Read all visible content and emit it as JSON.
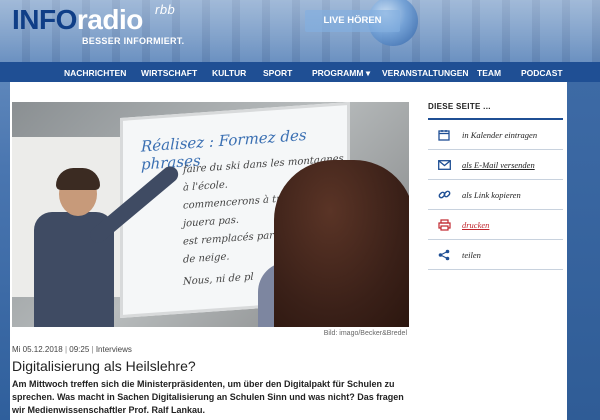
{
  "header": {
    "logo_info": "INFO",
    "logo_radio": "radio",
    "logo_rbb": "rbb",
    "tagline": "BESSER INFORMIERT.",
    "live_label": "LIVE HÖREN"
  },
  "nav": {
    "items": [
      {
        "label": "NACHRICHTEN"
      },
      {
        "label": "WIRTSCHAFT"
      },
      {
        "label": "KULTUR"
      },
      {
        "label": "SPORT"
      },
      {
        "label": "PROGRAMM ▾"
      },
      {
        "label": "VERANSTALTUNGEN"
      },
      {
        "label": "TEAM"
      },
      {
        "label": "PODCAST"
      }
    ]
  },
  "article": {
    "image_caption": "Bild: imago/Becker&Bredel",
    "board_title": "Réalisez : Formez des phrases",
    "board_lines": [
      "faire du ski dans les montagnes.",
      "à l'école.",
      "commencerons à travailler",
      "jouera pas.",
      "est remplacés par des",
      "de neige.",
      "Nous, ni de pl"
    ],
    "date": "Mi 05.12.2018",
    "time": "09:25",
    "category": "Interviews",
    "headline": "Digitalisierung als Heilslehre?",
    "teaser": "Am Mittwoch treffen sich die Ministerpräsidenten, um über den Digitalpakt für Schulen zu sprechen. Was macht in Sachen Digitalisierung an Schulen Sinn und was nicht? Das fragen wir Medienwissenschaftler Prof. Ralf Lankau."
  },
  "sidebar": {
    "title": "DIESE SEITE ...",
    "items": [
      {
        "label": "in Kalender eintragen",
        "icon": "calendar-icon"
      },
      {
        "label": "als E-Mail versenden",
        "icon": "mail-icon"
      },
      {
        "label": "als Link kopieren",
        "icon": "link-icon"
      },
      {
        "label": "drucken",
        "icon": "print-icon"
      },
      {
        "label": "teilen",
        "icon": "share-icon"
      }
    ]
  },
  "colors": {
    "nav_bg": "#1f4f94",
    "accent_red": "#c0262d",
    "logo_blue": "#0f3e87"
  }
}
